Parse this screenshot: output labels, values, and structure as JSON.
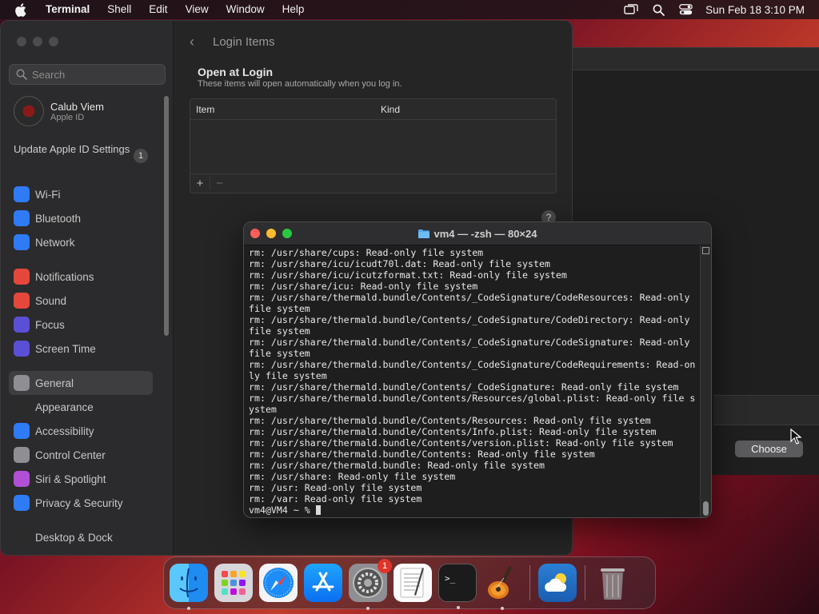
{
  "menubar": {
    "app_name": "Terminal",
    "menus": [
      "Shell",
      "Edit",
      "View",
      "Window",
      "Help"
    ],
    "clock": "Sun Feb 18  3:10 PM",
    "status_icons": [
      "screen-mirroring-icon",
      "spotlight-search-icon",
      "control-center-icon"
    ]
  },
  "settings": {
    "search_placeholder": "Search",
    "profile": {
      "name": "Calub Viem",
      "subtitle": "Apple ID"
    },
    "update_label": "Update Apple ID Settings",
    "update_badge": "1",
    "sidebar_groups": [
      [
        {
          "label": "Wi-Fi",
          "icon": "wifi-icon",
          "color": "#2f7bf5"
        },
        {
          "label": "Bluetooth",
          "icon": "bluetooth-icon",
          "color": "#2f7bf5"
        },
        {
          "label": "Network",
          "icon": "globe-icon",
          "color": "#2f7bf5"
        }
      ],
      [
        {
          "label": "Notifications",
          "icon": "bell-icon",
          "color": "#e5473d"
        },
        {
          "label": "Sound",
          "icon": "speaker-icon",
          "color": "#e5473d"
        },
        {
          "label": "Focus",
          "icon": "moon-icon",
          "color": "#5b4fd6"
        },
        {
          "label": "Screen Time",
          "icon": "hourglass-icon",
          "color": "#5b4fd6"
        }
      ],
      [
        {
          "label": "General",
          "icon": "gear-icon",
          "color": "#8e8e93",
          "active": true
        },
        {
          "label": "Appearance",
          "icon": "appearance-icon",
          "color": "#2b2b2b"
        },
        {
          "label": "Accessibility",
          "icon": "accessibility-icon",
          "color": "#2f7bf5"
        },
        {
          "label": "Control Center",
          "icon": "control-center-icon",
          "color": "#8e8e93"
        },
        {
          "label": "Siri & Spotlight",
          "icon": "siri-icon",
          "color": "#b14fd6"
        },
        {
          "label": "Privacy & Security",
          "icon": "hand-icon",
          "color": "#2f7bf5"
        }
      ],
      [
        {
          "label": "Desktop & Dock",
          "icon": "dock-icon",
          "color": "#2b2b2b"
        }
      ]
    ],
    "page_title": "Login Items",
    "section_title": "Open at Login",
    "section_subtitle": "These items will open automatically when you log in.",
    "table_headers": [
      "Item",
      "Kind"
    ],
    "add_label": "+",
    "remove_label": "−",
    "help_label": "?"
  },
  "dialog": {
    "choose_label": "Choose"
  },
  "terminal": {
    "title": "vm4 — -zsh — 80×24",
    "lines": [
      "rm: /usr/share/cups: Read-only file system",
      "rm: /usr/share/icu/icudt70l.dat: Read-only file system",
      "rm: /usr/share/icu/icutzformat.txt: Read-only file system",
      "rm: /usr/share/icu: Read-only file system",
      "rm: /usr/share/thermald.bundle/Contents/_CodeSignature/CodeResources: Read-only",
      "file system",
      "rm: /usr/share/thermald.bundle/Contents/_CodeSignature/CodeDirectory: Read-only",
      "file system",
      "rm: /usr/share/thermald.bundle/Contents/_CodeSignature/CodeSignature: Read-only",
      "file system",
      "rm: /usr/share/thermald.bundle/Contents/_CodeSignature/CodeRequirements: Read-on",
      "ly file system",
      "rm: /usr/share/thermald.bundle/Contents/_CodeSignature: Read-only file system",
      "rm: /usr/share/thermald.bundle/Contents/Resources/global.plist: Read-only file s",
      "ystem",
      "rm: /usr/share/thermald.bundle/Contents/Resources: Read-only file system",
      "rm: /usr/share/thermald.bundle/Contents/Info.plist: Read-only file system",
      "rm: /usr/share/thermald.bundle/Contents/version.plist: Read-only file system",
      "rm: /usr/share/thermald.bundle/Contents: Read-only file system",
      "rm: /usr/share/thermald.bundle: Read-only file system",
      "rm: /usr/share: Read-only file system",
      "rm: /usr: Read-only file system",
      "rm: /var: Read-only file system"
    ],
    "prompt": "vm4@VM4 ~ % "
  },
  "dock": {
    "apps": [
      {
        "name": "finder-icon",
        "running": true
      },
      {
        "name": "launchpad-icon",
        "running": false
      },
      {
        "name": "safari-icon",
        "running": false
      },
      {
        "name": "app-store-icon",
        "running": false
      },
      {
        "name": "system-settings-icon",
        "running": true,
        "badge": "1"
      },
      {
        "name": "textedit-icon",
        "running": false
      },
      {
        "name": "terminal-icon",
        "running": true
      },
      {
        "name": "garageband-icon",
        "running": true
      }
    ],
    "recent": [
      {
        "name": "weather-icon",
        "running": false
      }
    ],
    "trash": {
      "name": "trash-icon"
    }
  }
}
